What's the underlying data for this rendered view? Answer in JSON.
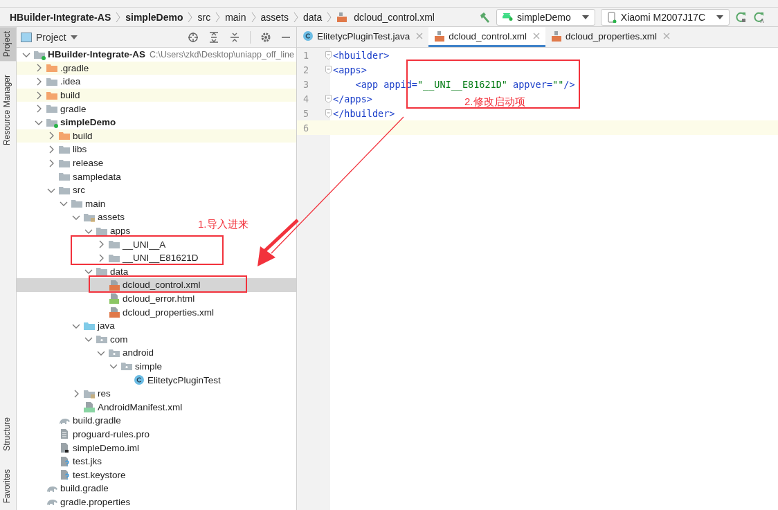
{
  "breadcrumb": [
    {
      "label": "HBuilder-Integrate-AS",
      "kind": "module"
    },
    {
      "label": "simpleDemo",
      "kind": "module"
    },
    {
      "label": "src",
      "kind": "folder"
    },
    {
      "label": "main",
      "kind": "folder"
    },
    {
      "label": "assets",
      "kind": "folder"
    },
    {
      "label": "data",
      "kind": "folder"
    },
    {
      "label": "dcloud_control.xml",
      "kind": "xml"
    }
  ],
  "toolbar": {
    "configuration": "simpleDemo",
    "device": "Xiaomi M2007J17C"
  },
  "side_tabs": [
    {
      "label": "Project",
      "selected": true
    },
    {
      "label": "Resource Manager",
      "selected": false
    },
    {
      "label": "Structure",
      "selected": false
    },
    {
      "label": "Favorites",
      "selected": false
    }
  ],
  "project_panel": {
    "title": "Project",
    "tree": [
      {
        "label": "HBuilder-Integrate-AS",
        "kind": "module",
        "path": "C:\\Users\\zkd\\Desktop\\uniapp_off_line",
        "expanded": true,
        "selected": false,
        "children": [
          {
            "label": ".gradle",
            "kind": "excluded-folder",
            "expanded": false,
            "selected": false
          },
          {
            "label": ".idea",
            "kind": "folder",
            "expanded": false,
            "selected": false
          },
          {
            "label": "build",
            "kind": "excluded-folder",
            "expanded": false,
            "selected": false
          },
          {
            "label": "gradle",
            "kind": "folder",
            "expanded": false,
            "selected": false
          },
          {
            "label": "simpleDemo",
            "kind": "module",
            "expanded": true,
            "selected": false,
            "children": [
              {
                "label": "build",
                "kind": "excluded-folder",
                "expanded": false,
                "selected": false
              },
              {
                "label": "libs",
                "kind": "folder",
                "expanded": false,
                "selected": false
              },
              {
                "label": "release",
                "kind": "folder",
                "expanded": false,
                "selected": false
              },
              {
                "label": "sampledata",
                "kind": "folder",
                "selected": false
              },
              {
                "label": "src",
                "kind": "folder",
                "expanded": true,
                "selected": false,
                "children": [
                  {
                    "label": "main",
                    "kind": "folder",
                    "expanded": true,
                    "selected": false,
                    "children": [
                      {
                        "label": "assets",
                        "kind": "resource-folder",
                        "expanded": true,
                        "selected": false,
                        "children": [
                          {
                            "label": "apps",
                            "kind": "folder",
                            "expanded": true,
                            "selected": false,
                            "children": [
                              {
                                "label": "__UNI__A",
                                "kind": "folder",
                                "expanded": false,
                                "selected": false
                              },
                              {
                                "label": "__UNI__E81621D",
                                "kind": "folder",
                                "expanded": false,
                                "selected": false
                              }
                            ]
                          },
                          {
                            "label": "data",
                            "kind": "folder",
                            "expanded": true,
                            "selected": false,
                            "children": [
                              {
                                "label": "dcloud_control.xml",
                                "kind": "xml",
                                "selected": true
                              },
                              {
                                "label": "dcloud_error.html",
                                "kind": "html",
                                "selected": false
                              },
                              {
                                "label": "dcloud_properties.xml",
                                "kind": "xml",
                                "selected": false
                              }
                            ]
                          }
                        ]
                      },
                      {
                        "label": "java",
                        "kind": "source-folder",
                        "expanded": true,
                        "selected": false,
                        "children": [
                          {
                            "label": "com",
                            "kind": "package",
                            "expanded": true,
                            "selected": false,
                            "children": [
                              {
                                "label": "android",
                                "kind": "package",
                                "expanded": true,
                                "selected": false,
                                "children": [
                                  {
                                    "label": "simple",
                                    "kind": "package",
                                    "expanded": true,
                                    "selected": false,
                                    "children": [
                                      {
                                        "label": "ElitetycPluginTest",
                                        "kind": "class",
                                        "selected": false
                                      }
                                    ]
                                  }
                                ]
                              }
                            ]
                          }
                        ]
                      },
                      {
                        "label": "res",
                        "kind": "resource-folder",
                        "expanded": false,
                        "selected": false
                      },
                      {
                        "label": "AndroidManifest.xml",
                        "kind": "manifest",
                        "selected": false
                      }
                    ]
                  }
                ]
              },
              {
                "label": "build.gradle",
                "kind": "gradle",
                "selected": false
              },
              {
                "label": "proguard-rules.pro",
                "kind": "text",
                "selected": false
              },
              {
                "label": "simpleDemo.iml",
                "kind": "iml",
                "selected": false
              },
              {
                "label": "test.jks",
                "kind": "unknown",
                "selected": false
              },
              {
                "label": "test.keystore",
                "kind": "unknown",
                "selected": false
              }
            ]
          },
          {
            "label": "build.gradle",
            "kind": "gradle",
            "selected": false
          },
          {
            "label": "gradle.properties",
            "kind": "gradle-file",
            "selected": false
          }
        ]
      }
    ]
  },
  "editor": {
    "tabs": [
      {
        "label": "ElitetycPluginTest.java",
        "kind": "class",
        "selected": false
      },
      {
        "label": "dcloud_control.xml",
        "kind": "xml",
        "selected": true
      },
      {
        "label": "dcloud_properties.xml",
        "kind": "xml",
        "selected": false
      }
    ],
    "lines": [
      {
        "number": "1",
        "current": false,
        "fold": true,
        "tokens": [
          {
            "text": "<hbuilder>",
            "kind": "tag"
          }
        ]
      },
      {
        "number": "2",
        "current": false,
        "fold": true,
        "tokens": [
          {
            "text": "<apps>",
            "kind": "tag"
          }
        ]
      },
      {
        "number": "3",
        "current": false,
        "fold": false,
        "tokens": [
          {
            "text": "    <app ",
            "kind": "tag"
          },
          {
            "text": "appid=",
            "kind": "attr"
          },
          {
            "text": "\"__UNI__E81621D\"",
            "kind": "value"
          },
          {
            "text": " appver=",
            "kind": "attr"
          },
          {
            "text": "\"\"",
            "kind": "value"
          },
          {
            "text": "/>",
            "kind": "tag"
          }
        ]
      },
      {
        "number": "4",
        "current": false,
        "fold": true,
        "tokens": [
          {
            "text": "</apps>",
            "kind": "tag"
          }
        ]
      },
      {
        "number": "5",
        "current": false,
        "fold": true,
        "tokens": [
          {
            "text": "</hbuilder>",
            "kind": "tag"
          }
        ]
      },
      {
        "number": "6",
        "current": true,
        "fold": false
      }
    ]
  },
  "annotations": [
    "1.导入进来",
    "2.修改启动项"
  ]
}
